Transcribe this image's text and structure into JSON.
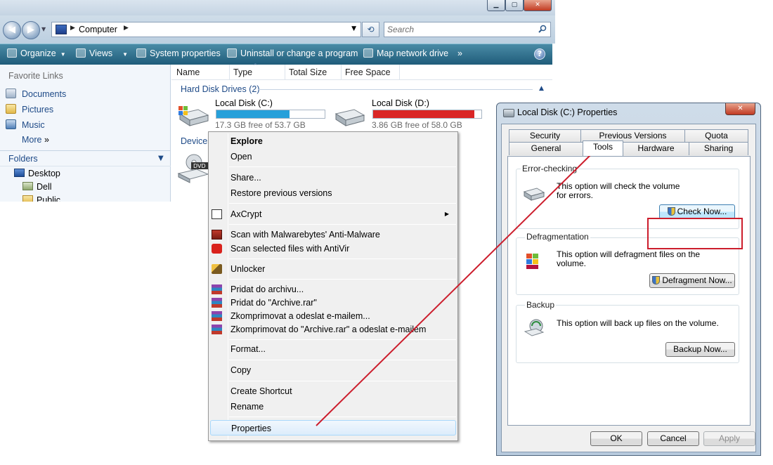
{
  "explorer": {
    "address": {
      "location": "Computer"
    },
    "search": {
      "placeholder": "Search"
    },
    "toolbar": {
      "organize": "Organize",
      "views": "Views",
      "system_properties": "System properties",
      "uninstall": "Uninstall or change a program",
      "map_drive": "Map network drive",
      "overflow": "»",
      "help": "?"
    },
    "nav_pane": {
      "favorites_title": "Favorite Links",
      "favorites": [
        "Documents",
        "Pictures",
        "Music"
      ],
      "more": "More",
      "more_arrows": "»",
      "folders_title": "Folders",
      "tree": [
        "Desktop",
        "Dell",
        "Public"
      ]
    },
    "columns": [
      "Name",
      "Type",
      "Total Size",
      "Free Space"
    ],
    "group_hard_disks": "Hard Disk Drives (2)",
    "group_devices": "Devices",
    "drives": [
      {
        "name": "Local Disk (C:)",
        "free_text": "17.3 GB free of 53.7 GB",
        "used_fraction": 0.678,
        "bar_color": "#26a0da"
      },
      {
        "name": "Local Disk (D:)",
        "free_text": "3.86 GB free of 58.0 GB",
        "used_fraction": 0.933,
        "bar_color": "#da2626"
      }
    ]
  },
  "context_menu": {
    "explore": "Explore",
    "open": "Open",
    "share": "Share...",
    "restore": "Restore previous versions",
    "axcrypt": "AxCrypt",
    "malwarebytes": "Scan with Malwarebytes' Anti-Malware",
    "antivir": "Scan selected files with AntiVir",
    "unlocker": "Unlocker",
    "pridat": "Pridat do archivu...",
    "pridat_rar": "Pridat do \"Archive.rar\"",
    "zkomprimovat": "Zkomprimovat a odeslat e-mailem...",
    "zkomprimovat_rar": "Zkomprimovat do \"Archive.rar\" a odeslat e-mailem",
    "format": "Format...",
    "copy": "Copy",
    "create_shortcut": "Create Shortcut",
    "rename": "Rename",
    "properties": "Properties"
  },
  "dialog": {
    "title": "Local Disk (C:) Properties",
    "tabs_top": [
      "Security",
      "Previous Versions",
      "Quota"
    ],
    "tabs_bottom": [
      "General",
      "Tools",
      "Hardware",
      "Sharing"
    ],
    "error_checking": {
      "title": "Error-checking",
      "desc": "This option will check the volume for errors.",
      "button": "Check Now..."
    },
    "defrag": {
      "title": "Defragmentation",
      "desc": "This option will defragment files on the volume.",
      "button": "Defragment Now..."
    },
    "backup": {
      "title": "Backup",
      "desc": "This option will back up files on the volume.",
      "button": "Backup Now..."
    },
    "ok": "OK",
    "cancel": "Cancel",
    "apply": "Apply"
  },
  "colors": {
    "annotation": "#cc1d2c",
    "toolbar": "#1f5c7a",
    "link": "#1e4a87"
  }
}
